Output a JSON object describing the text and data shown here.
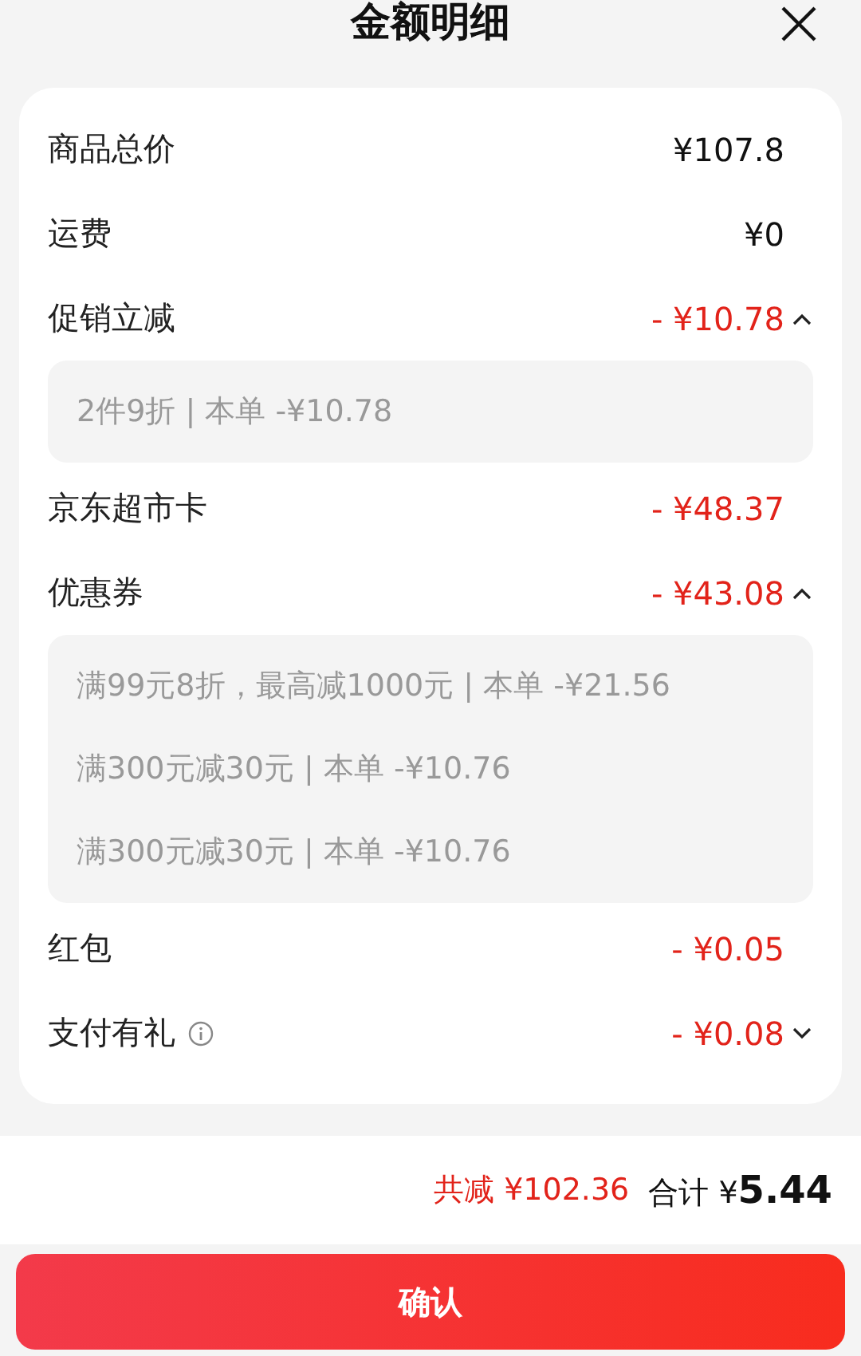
{
  "title": "金额明细",
  "rows": [
    {
      "label": "商品总价",
      "value": "¥107.8",
      "kind": "plain"
    },
    {
      "label": "运费",
      "value": "¥0",
      "kind": "plain"
    },
    {
      "label": "促销立减",
      "value": "- ¥10.78",
      "kind": "discount",
      "expanded": true,
      "details": [
        "2件9折 | 本单 -¥10.78"
      ]
    },
    {
      "label": "京东超市卡",
      "value": "- ¥48.37",
      "kind": "discount"
    },
    {
      "label": "优惠券",
      "value": "- ¥43.08",
      "kind": "discount",
      "expanded": true,
      "details": [
        "满99元8折，最高减1000元 | 本单 -¥21.56",
        "满300元减30元 | 本单 -¥10.76",
        "满300元减30元 | 本单 -¥10.76"
      ]
    },
    {
      "label": "红包",
      "value": "- ¥0.05",
      "kind": "discount"
    },
    {
      "label": "支付有礼",
      "value": "- ¥0.08",
      "kind": "discount",
      "info": true,
      "expanded": false
    }
  ],
  "summary": {
    "saved_label": "共减",
    "saved_value": "¥102.36",
    "total_label": "合计",
    "total_currency": "¥",
    "total_value": "5.44"
  },
  "confirm_button": "确认"
}
